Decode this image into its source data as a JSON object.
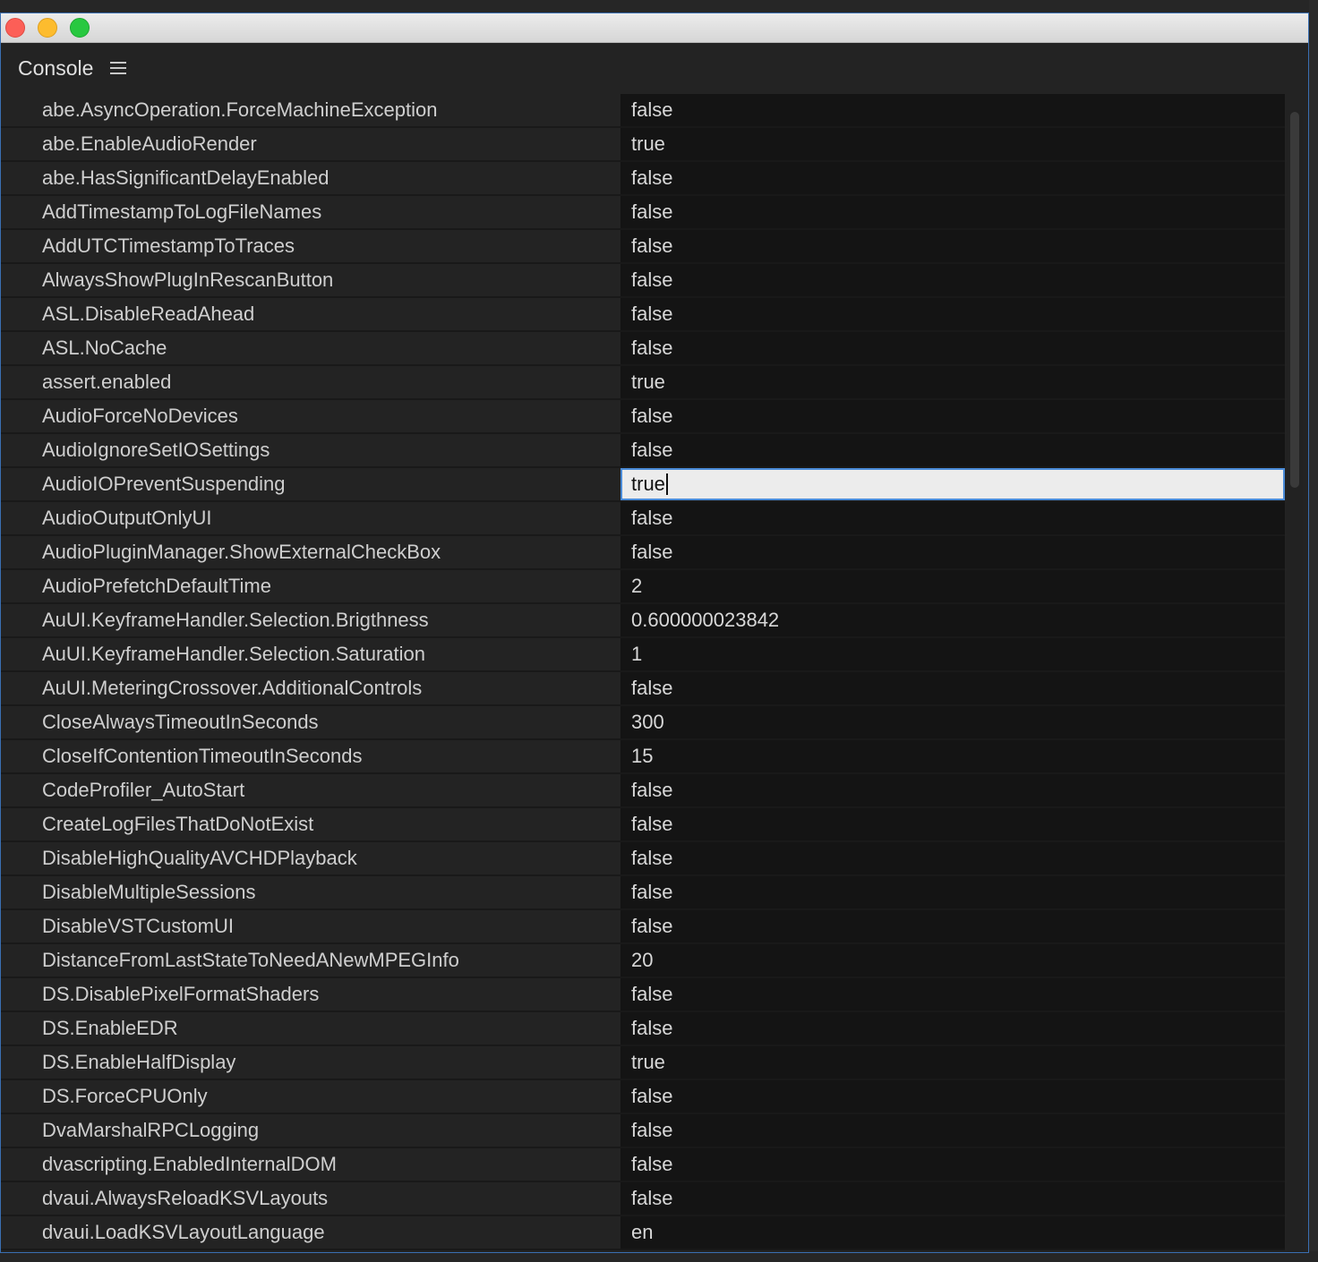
{
  "panel": {
    "title": "Console"
  },
  "icons": {
    "menu": "hamburger-menu-icon"
  },
  "rows": [
    {
      "key": "abe.AsyncOperation.ForceMachineException",
      "value": "false"
    },
    {
      "key": "abe.EnableAudioRender",
      "value": "true"
    },
    {
      "key": "abe.HasSignificantDelayEnabled",
      "value": "false"
    },
    {
      "key": "AddTimestampToLogFileNames",
      "value": "false"
    },
    {
      "key": "AddUTCTimestampToTraces",
      "value": "false"
    },
    {
      "key": "AlwaysShowPlugInRescanButton",
      "value": "false"
    },
    {
      "key": "ASL.DisableReadAhead",
      "value": "false"
    },
    {
      "key": "ASL.NoCache",
      "value": "false"
    },
    {
      "key": "assert.enabled",
      "value": "true"
    },
    {
      "key": "AudioForceNoDevices",
      "value": "false"
    },
    {
      "key": "AudioIgnoreSetIOSettings",
      "value": "false"
    },
    {
      "key": "AudioIOPreventSuspending",
      "value": "true",
      "editing": true
    },
    {
      "key": "AudioOutputOnlyUI",
      "value": "false"
    },
    {
      "key": "AudioPluginManager.ShowExternalCheckBox",
      "value": "false"
    },
    {
      "key": "AudioPrefetchDefaultTime",
      "value": "2"
    },
    {
      "key": "AuUI.KeyframeHandler.Selection.Brigthness",
      "value": "0.600000023842"
    },
    {
      "key": "AuUI.KeyframeHandler.Selection.Saturation",
      "value": "1"
    },
    {
      "key": "AuUI.MeteringCrossover.AdditionalControls",
      "value": "false"
    },
    {
      "key": "CloseAlwaysTimeoutInSeconds",
      "value": "300"
    },
    {
      "key": "CloseIfContentionTimeoutInSeconds",
      "value": "15"
    },
    {
      "key": "CodeProfiler_AutoStart",
      "value": "false"
    },
    {
      "key": "CreateLogFilesThatDoNotExist",
      "value": "false"
    },
    {
      "key": "DisableHighQualityAVCHDPlayback",
      "value": "false"
    },
    {
      "key": "DisableMultipleSessions",
      "value": "false"
    },
    {
      "key": "DisableVSTCustomUI",
      "value": "false"
    },
    {
      "key": "DistanceFromLastStateToNeedANewMPEGInfo",
      "value": "20"
    },
    {
      "key": "DS.DisablePixelFormatShaders",
      "value": "false"
    },
    {
      "key": "DS.EnableEDR",
      "value": "false"
    },
    {
      "key": "DS.EnableHalfDisplay",
      "value": "true"
    },
    {
      "key": "DS.ForceCPUOnly",
      "value": "false"
    },
    {
      "key": "DvaMarshalRPCLogging",
      "value": "false"
    },
    {
      "key": "dvascripting.EnabledInternalDOM",
      "value": "false"
    },
    {
      "key": "dvaui.AlwaysReloadKSVLayouts",
      "value": "false"
    },
    {
      "key": "dvaui.LoadKSVLayoutLanguage",
      "value": "en"
    }
  ]
}
